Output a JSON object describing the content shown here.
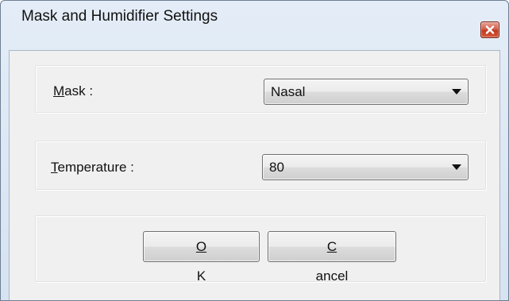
{
  "window": {
    "title": "Mask and Humidifier Settings",
    "close_icon": "close-icon"
  },
  "mask": {
    "label_access_key": "M",
    "label_rest": "ask :",
    "selected": "Nasal"
  },
  "temperature": {
    "label_access_key": "T",
    "label_rest": "emperature :",
    "selected": "80"
  },
  "buttons": {
    "ok_access_key": "O",
    "ok_rest": "K",
    "cancel_access_key": "C",
    "cancel_rest": "ancel"
  },
  "colors": {
    "window_frame": "#d6e3f1",
    "client_bg": "#f0f0f0",
    "close_button": "#c1391f"
  }
}
